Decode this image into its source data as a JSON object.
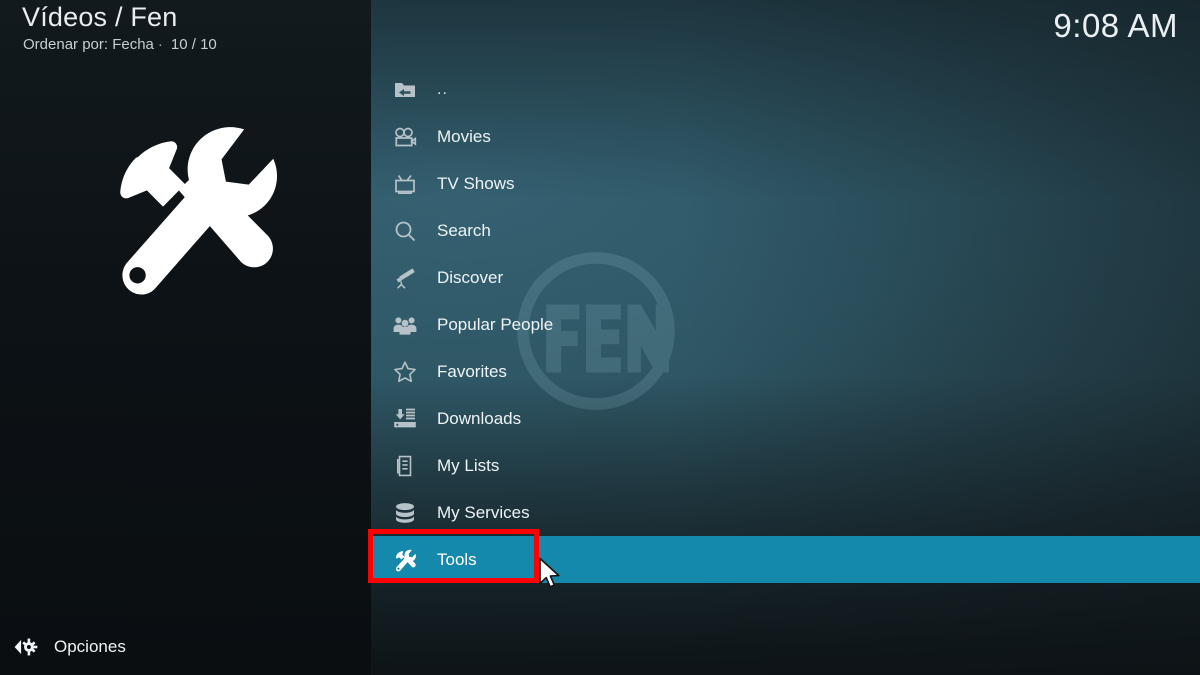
{
  "window": {
    "skin": "Kodi Estuary",
    "clock": "9:08 AM"
  },
  "info_panel": {
    "title": "Vídeos / Fen",
    "sort_label": "Ordenar por: Fecha",
    "separator": "·",
    "item_count": "10 / 10",
    "logo_icon": "hammer-and-wrench-icon",
    "options_button": {
      "label": "Opciones",
      "icon": "left-arrow-gear-icon"
    }
  },
  "menu": {
    "selected_index": 10,
    "highlight_color": "#1489ab",
    "items": [
      {
        "label": "..",
        "icon": "folder-back-icon"
      },
      {
        "label": "Movies",
        "icon": "movie-camera-icon"
      },
      {
        "label": "TV Shows",
        "icon": "television-icon"
      },
      {
        "label": "Search",
        "icon": "magnifier-icon"
      },
      {
        "label": "Discover",
        "icon": "telescope-icon"
      },
      {
        "label": "Popular People",
        "icon": "people-group-icon"
      },
      {
        "label": "Favorites",
        "icon": "star-outline-icon"
      },
      {
        "label": "Downloads",
        "icon": "download-drive-icon"
      },
      {
        "label": "My Lists",
        "icon": "documents-icon"
      },
      {
        "label": "My Services",
        "icon": "database-icon"
      },
      {
        "label": "Tools",
        "icon": "hammer-and-wrench-icon"
      }
    ]
  },
  "annotation": {
    "highlight_box_color": "#fe0000",
    "target_label": "Tools"
  },
  "background": {
    "watermark_text": "FEN",
    "watermark_icon": "fen-logo-watermark"
  }
}
